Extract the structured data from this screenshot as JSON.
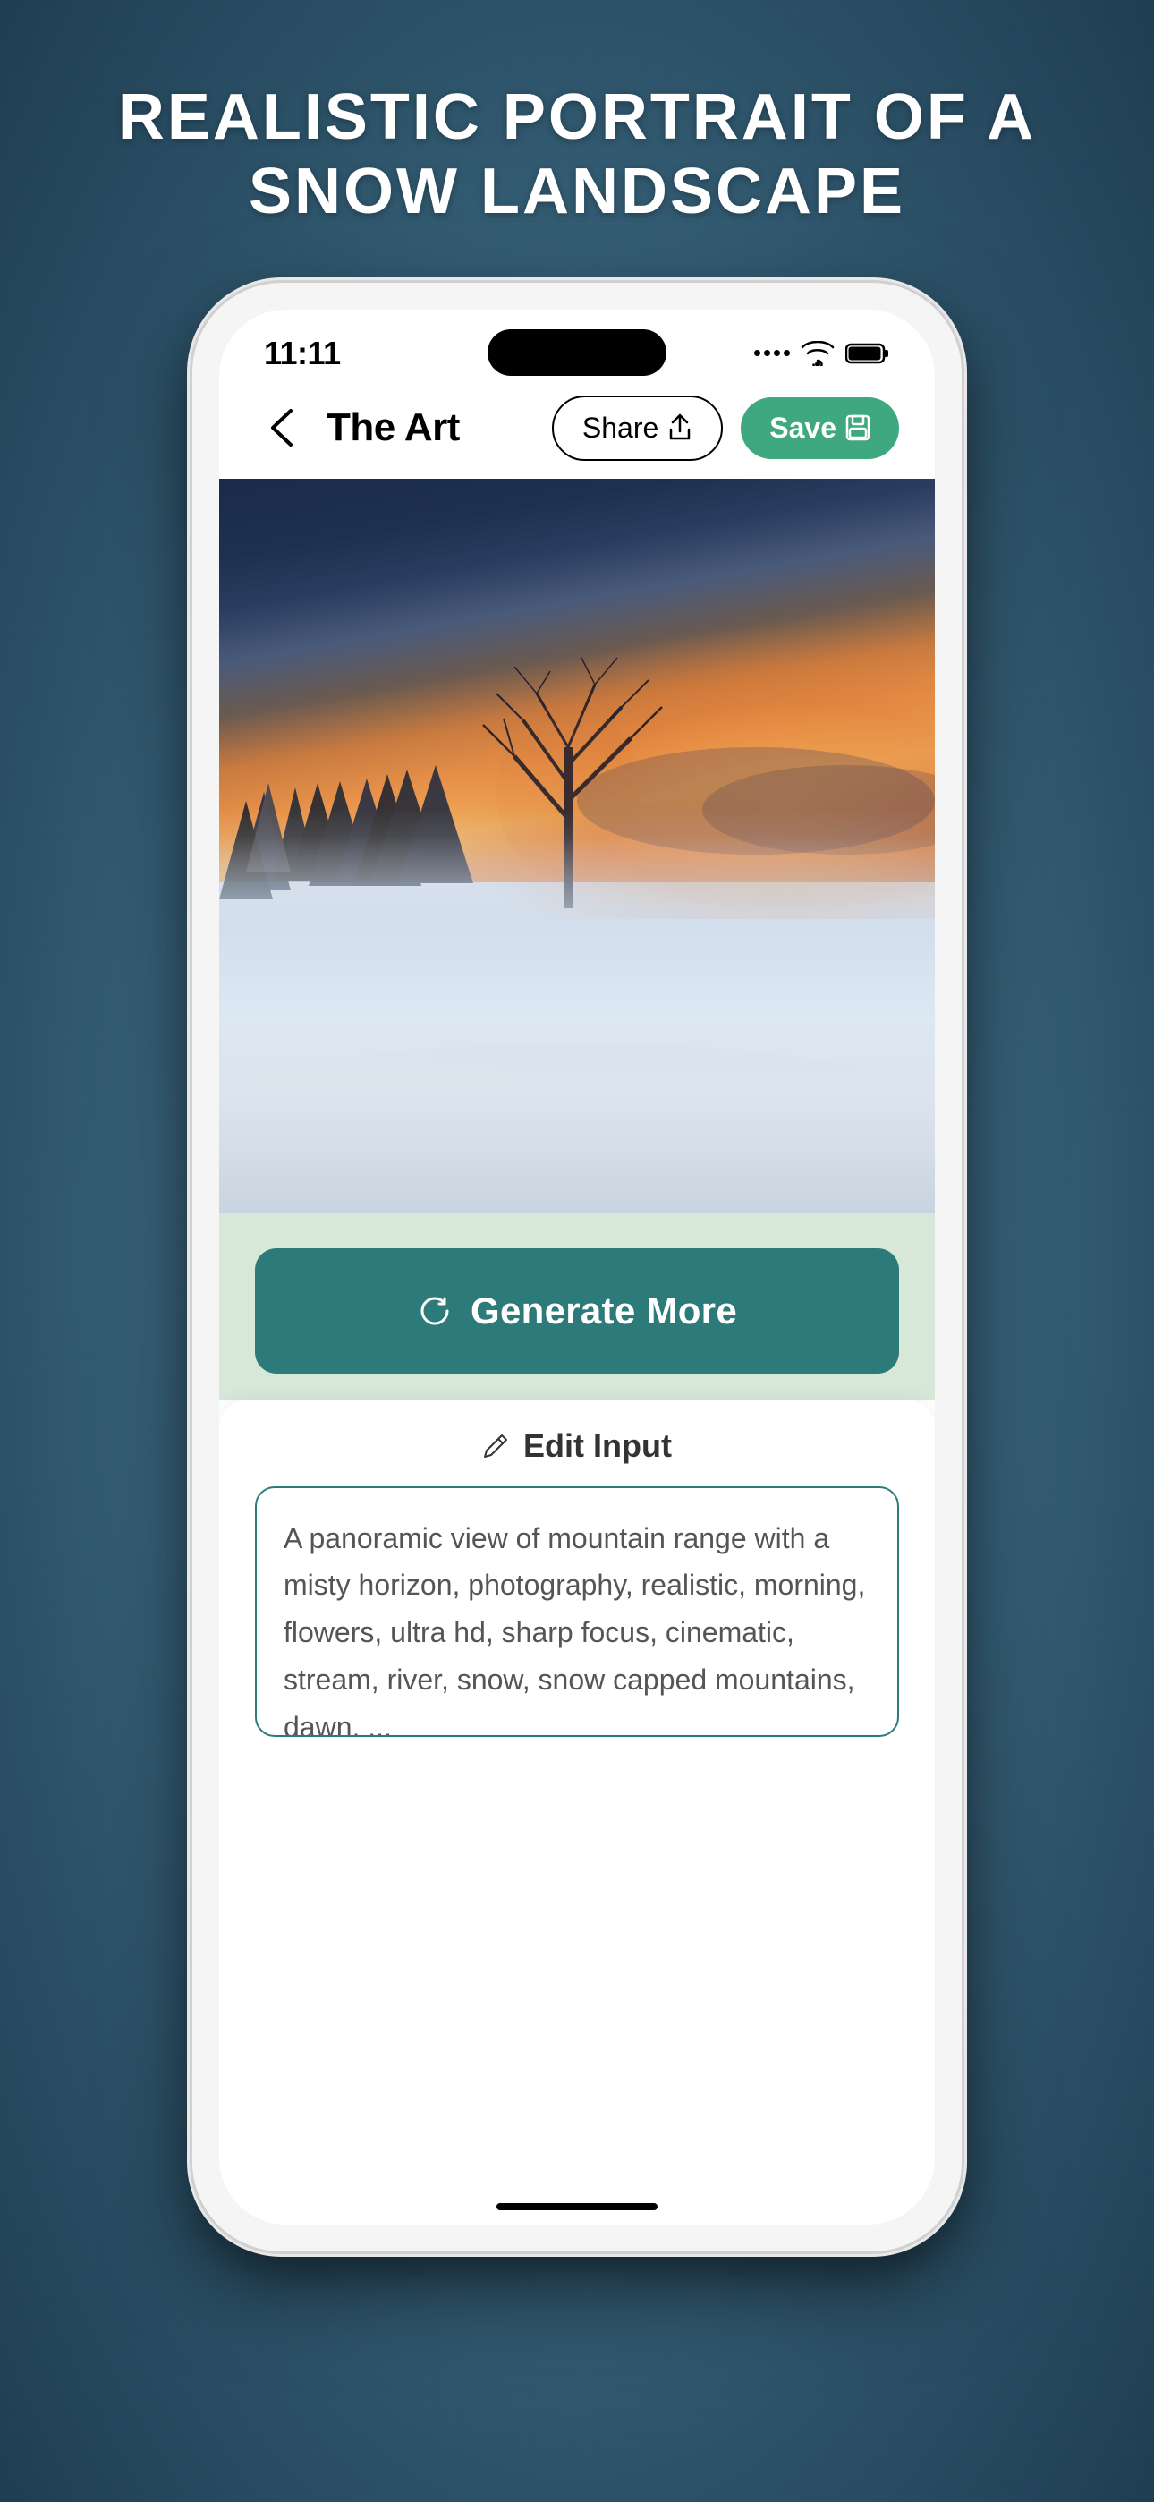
{
  "page": {
    "title": "REALISTIC PORTRAIT OF A\nSNOW LANDSCAPE"
  },
  "status_bar": {
    "time": "11:11",
    "signal_dots": 4,
    "wifi_label": "wifi",
    "battery_label": "battery"
  },
  "nav": {
    "back_label": "‹",
    "title": "The Art",
    "share_label": "Share",
    "save_label": "Save"
  },
  "image": {
    "alt": "Realistic portrait of a snow landscape with trees and sunset"
  },
  "generate_button": {
    "label": "Generate More",
    "icon": "refresh"
  },
  "edit_section": {
    "header": "Edit Input",
    "textarea_value": "A panoramic view of mountain range with a misty horizon, photography, realistic, morning, flowers, ultra hd, sharp focus, cinematic, stream, river, snow, snow capped mountains, dawn, ..."
  }
}
